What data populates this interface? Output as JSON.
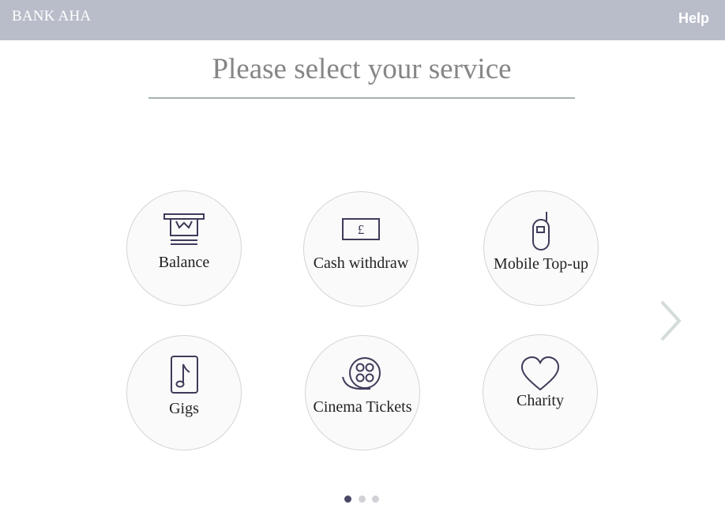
{
  "header": {
    "brand": "BANK AHA",
    "help_label": "Help"
  },
  "page": {
    "title": "Please select your service"
  },
  "services": [
    {
      "label": "Balance",
      "icon": "atm-receipt-icon"
    },
    {
      "label": "Cash withdraw",
      "icon": "banknote-pound-icon"
    },
    {
      "label": "Mobile Top-up",
      "icon": "mobile-phone-icon"
    },
    {
      "label": "Gigs",
      "icon": "music-note-icon"
    },
    {
      "label": "Cinema Tickets",
      "icon": "film-reel-icon"
    },
    {
      "label": "Charity",
      "icon": "heart-icon"
    }
  ],
  "banknote_symbol": "£",
  "pagination": {
    "total": 3,
    "current": 1
  },
  "colors": {
    "header_bg": "#b9bdca",
    "icon_stroke": "#3e3c5a",
    "title_text": "#878585",
    "dot_active": "#4a4766",
    "dot_inactive": "#d2d2d6"
  }
}
